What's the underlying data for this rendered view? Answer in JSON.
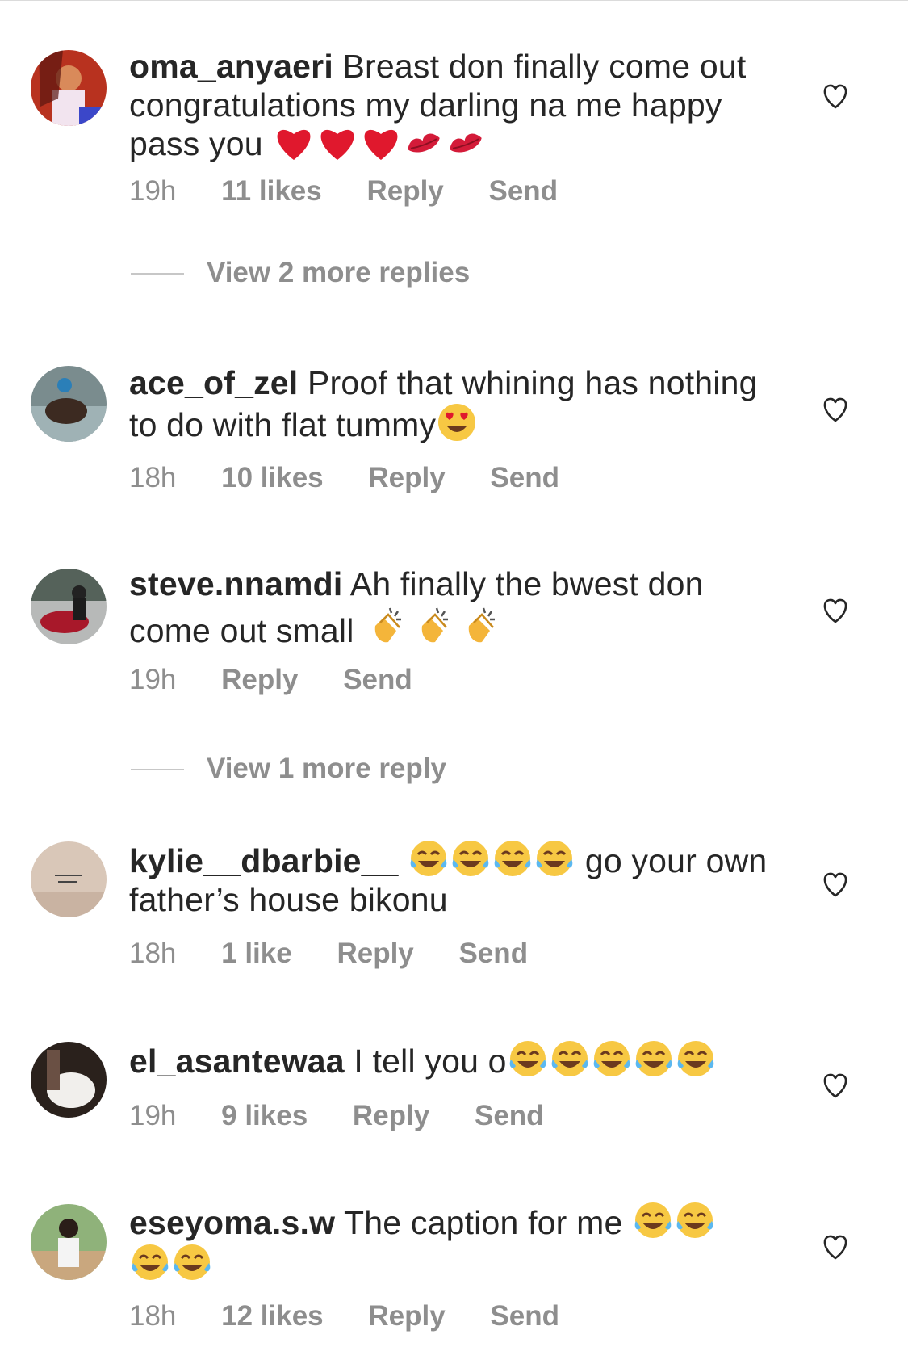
{
  "comments": [
    {
      "username": "oma_anyaeri",
      "text": "Breast don finally come out congratulations my darling na me happy pass you",
      "emojis": [
        "heart",
        "heart",
        "heart",
        "kiss",
        "kiss"
      ],
      "time": "19h",
      "likes": "11 likes",
      "reply": "Reply",
      "send": "Send",
      "avatar_color": "#c0392b"
    },
    {
      "username": "ace_of_zel",
      "text": "Proof that whining has nothing to do with flat tummy",
      "emojis": [
        "heart-eyes"
      ],
      "time": "18h",
      "likes": "10 likes",
      "reply": "Reply",
      "send": "Send",
      "avatar_color": "#6b7e86"
    },
    {
      "username": "steve.nnamdi",
      "text": "Ah finally the bwest don come out small",
      "emojis": [
        "clap",
        "clap",
        "clap"
      ],
      "time": "19h",
      "likes": "",
      "reply": "Reply",
      "send": "Send",
      "avatar_color": "#8a1d2b"
    },
    {
      "username": "kylie__dbarbie__",
      "text": "go your own father’s house bikonu",
      "emojis": [
        "joy",
        "joy",
        "joy",
        "joy"
      ],
      "time": "18h",
      "likes": "1 like",
      "reply": "Reply",
      "send": "Send",
      "avatar_color": "#d9c7b8"
    },
    {
      "username": "el_asantewaa",
      "text": "I tell you o",
      "emojis": [
        "joy",
        "joy",
        "joy",
        "joy",
        "joy"
      ],
      "time": "19h",
      "likes": "9 likes",
      "reply": "Reply",
      "send": "Send",
      "avatar_color": "#3a2c25"
    },
    {
      "username": "eseyoma.s.w",
      "text": "The caption for me",
      "emojis": [
        "joy",
        "joy",
        "joy",
        "joy"
      ],
      "time": "18h",
      "likes": "12 likes",
      "reply": "Reply",
      "send": "Send",
      "avatar_color": "#7fa56a"
    }
  ],
  "view_replies": [
    {
      "label": "View 2 more replies"
    },
    {
      "label": "View 1 more reply"
    }
  ],
  "icons": {
    "like": "heart-outline-icon"
  },
  "colors": {
    "text": "#262626",
    "muted": "#8e8e8e",
    "joy": "#f7c843",
    "heart": "#e0182d",
    "clap": "#f4b53a"
  }
}
